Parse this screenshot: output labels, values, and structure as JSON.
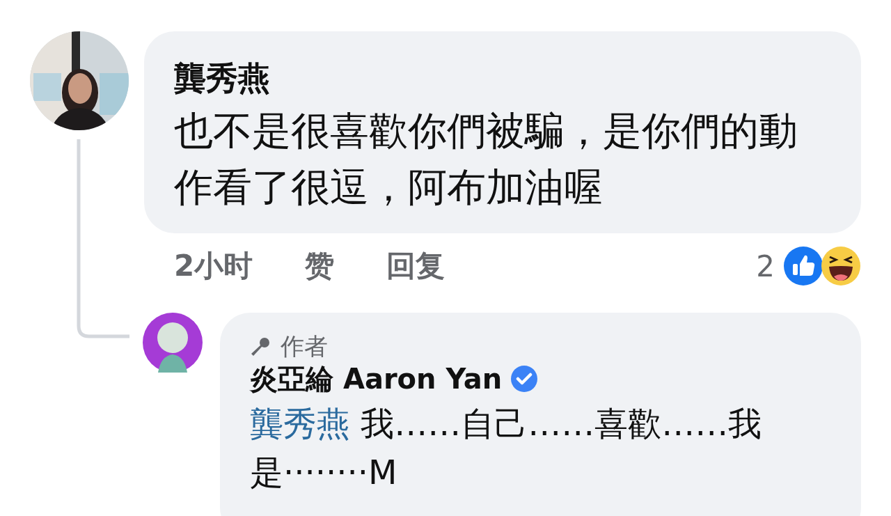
{
  "comment": {
    "author": "龔秀燕",
    "body": "也不是很喜歡你們被騙，是你們的動作看了很逗，阿布加油喔",
    "time": "2小时",
    "actions": [
      "赞",
      "回复"
    ],
    "reactions": {
      "count": "2",
      "icons": [
        {
          "kind": "like"
        },
        {
          "kind": "haha"
        }
      ]
    }
  },
  "reply": {
    "badge": "作者",
    "author": "炎亞綸 Aaron Yan",
    "verified": true,
    "mention": "龔秀燕",
    "body": "我……自己……喜歡……我是········M"
  }
}
